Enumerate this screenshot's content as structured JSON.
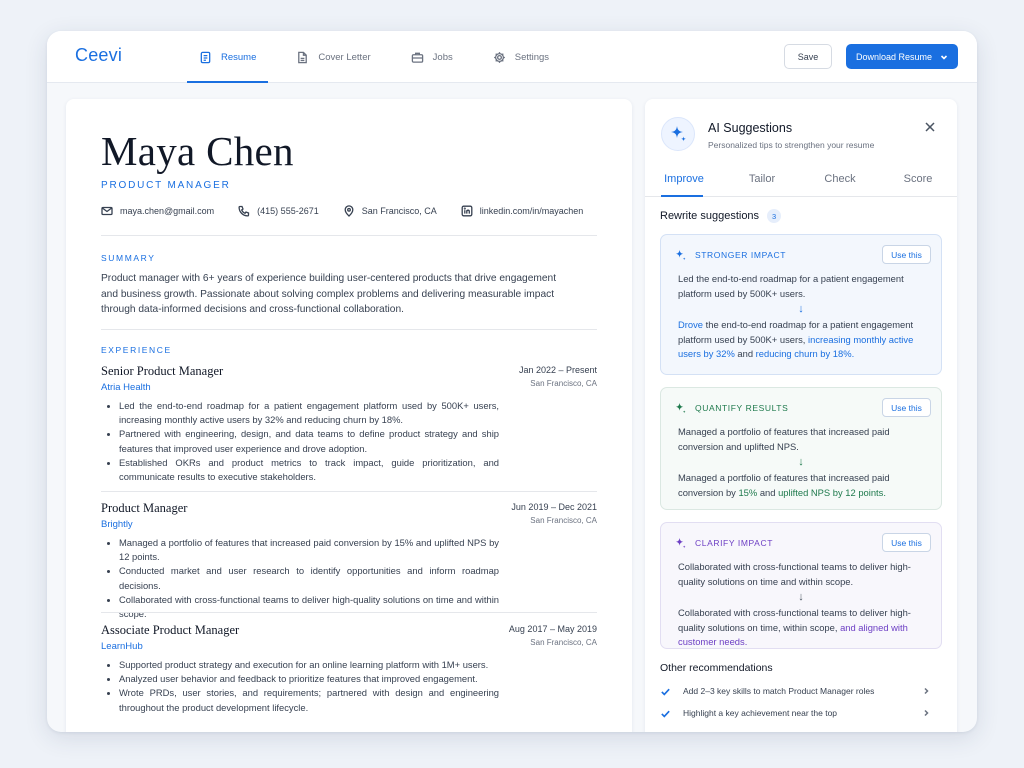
{
  "app": {
    "logo": "Ceevi"
  },
  "nav": {
    "tabs": [
      {
        "label": "Resume",
        "icon": "document-icon",
        "active": true
      },
      {
        "label": "Cover Letter",
        "icon": "file-icon",
        "active": false
      },
      {
        "label": "Jobs",
        "icon": "briefcase-icon",
        "active": false
      },
      {
        "label": "Settings",
        "icon": "gear-icon",
        "active": false
      }
    ]
  },
  "toolbar": {
    "save_label": "Save",
    "download_label": "Download Resume"
  },
  "resume": {
    "name": "Maya Chen",
    "role": "PRODUCT MANAGER",
    "contacts": {
      "email": "maya.chen@gmail.com",
      "phone": "(415) 555-2671",
      "location": "San Francisco, CA",
      "linkedin": "linkedin.com/in/mayachen"
    },
    "summary_heading": "SUMMARY",
    "summary": "Product manager with 6+ years of experience building user-centered products that drive engagement and business growth. Passionate about solving complex problems and delivering measurable impact through data-informed decisions and cross-functional collaboration.",
    "experience_heading": "EXPERIENCE",
    "jobs": [
      {
        "title": "Senior Product Manager",
        "company": "Atria Health",
        "dates": "Jan 2022 – Present",
        "location": "San Francisco, CA",
        "bullets": [
          "Led the end-to-end roadmap for a patient engagement platform used by 500K+ users, increasing monthly active users by 32% and reducing churn by 18%.",
          "Partnered with engineering, design, and data teams to define product strategy and ship features that improved user experience and drove adoption.",
          "Established OKRs and product metrics to track impact, guide prioritization, and communicate results to executive stakeholders."
        ]
      },
      {
        "title": "Product Manager",
        "company": "Brightly",
        "dates": "Jun 2019 – Dec 2021",
        "location": "San Francisco, CA",
        "bullets": [
          "Managed a portfolio of features that increased paid conversion by 15% and uplifted NPS by 12 points.",
          "Conducted market and user research to identify opportunities and inform roadmap decisions.",
          "Collaborated with cross-functional teams to deliver high-quality solutions on time and within scope."
        ]
      },
      {
        "title": "Associate Product Manager",
        "company": "LearnHub",
        "dates": "Aug 2017 – May 2019",
        "location": "San Francisco, CA",
        "bullets": [
          "Supported product strategy and execution for an online learning platform with 1M+ users.",
          "Analyzed user behavior and feedback to prioritize features that improved engagement.",
          "Wrote PRDs, user stories, and requirements; partnered with design and engineering throughout the product development lifecycle."
        ]
      }
    ]
  },
  "ai": {
    "title": "AI Suggestions",
    "subtitle": "Personalized tips to strengthen your resume",
    "tabs": [
      "Improve",
      "Tailor",
      "Check",
      "Score"
    ],
    "rewrite_heading": "Rewrite suggestions",
    "rewrite_count": "3",
    "use_label": "Use this",
    "arrow": "↓",
    "cards": [
      {
        "label": "STRONGER IMPACT",
        "color": "#1a6fe0",
        "original": "Led the end-to-end roadmap for a patient engagement platform used by 500K+ users.",
        "improved": [
          {
            "text": "Drove",
            "hl": true
          },
          {
            "text": " the end-to-end roadmap for a patient engagement platform used by 500K+ users, ",
            "hl": false
          },
          {
            "text": "increasing monthly active users by 32%",
            "hl": true
          },
          {
            "text": " and ",
            "hl": false
          },
          {
            "text": "reducing churn by 18%.",
            "hl": true
          }
        ]
      },
      {
        "label": "QUANTIFY RESULTS",
        "color": "#1f7a4d",
        "original": "Managed a portfolio of features that increased paid conversion and uplifted NPS.",
        "improved": [
          {
            "text": "Managed a portfolio of features that increased paid conversion by ",
            "hl": false
          },
          {
            "text": "15%",
            "hl": true
          },
          {
            "text": " and ",
            "hl": false
          },
          {
            "text": "uplifted NPS by 12 points.",
            "hl": true
          }
        ]
      },
      {
        "label": "CLARIFY IMPACT",
        "color": "#6d3fc4",
        "original": "Collaborated with cross-functional teams to deliver high-quality solutions on time and within scope.",
        "improved": [
          {
            "text": "Collaborated with cross-functional teams to deliver high-quality solutions on time, within scope, ",
            "hl": false
          },
          {
            "text": "and aligned with customer needs.",
            "hl": true
          }
        ]
      }
    ],
    "other_heading": "Other recommendations",
    "recommendations": [
      "Add 2–3 key skills to match Product Manager roles",
      "Highlight a key achievement near the top"
    ]
  }
}
